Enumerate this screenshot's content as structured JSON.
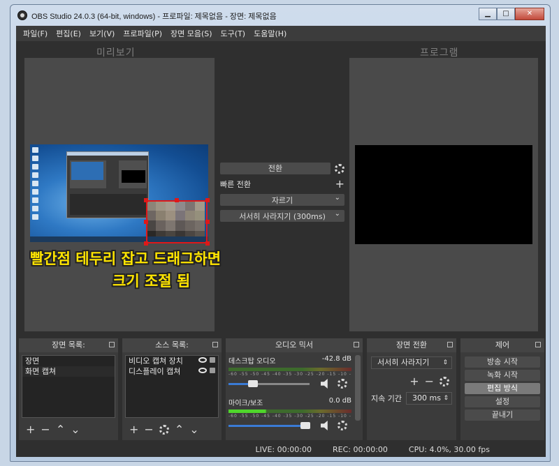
{
  "window": {
    "title": "OBS Studio 24.0.3 (64-bit, windows) - 프로파일: 제목없음 - 장면: 제목없음",
    "minimize": "▁",
    "maximize": "□",
    "close": "✕"
  },
  "menu": [
    "파일(F)",
    "편집(E)",
    "보기(V)",
    "프로파일(P)",
    "장면 모음(S)",
    "도구(T)",
    "도움말(H)"
  ],
  "preview_label": "미리보기",
  "program_label": "프로그램",
  "annotation": {
    "line1": "빨간점 테두리 잡고 드래그하면",
    "line2": "크기 조절 됨"
  },
  "transition_panel": {
    "transition_button": "전환",
    "quick_transition": "빠른 전환",
    "quick_plus": "+",
    "cut_option": "자르기",
    "fade_option": "서서히 사라지기 (300ms)"
  },
  "docks": {
    "scenes": {
      "title": "장면 목록:",
      "items": [
        "장면",
        "화면 캡쳐"
      ]
    },
    "sources": {
      "title": "소스 목록:",
      "items": [
        "비디오 캡쳐 장치",
        "디스플레이 캡쳐"
      ]
    },
    "mixer": {
      "title": "오디오 믹서",
      "ticks": "-60 -55 -50 -45 -40 -35 -30 -25 -20 -15 -10 -5 0",
      "channels": [
        {
          "name": "데스크탑 오디오",
          "level": "-42.8 dB",
          "volume": 0.3
        },
        {
          "name": "마이크/보조",
          "level": "0.0 dB",
          "volume": 0.95
        }
      ]
    },
    "scene_transition": {
      "title": "장면 전환",
      "selected": "서서히 사라지기",
      "duration_label": "지속 기간",
      "duration_value": "300 ms"
    },
    "controls": {
      "title": "제어",
      "buttons": [
        "방송 시작",
        "녹화 시작",
        "편집 방식",
        "설정",
        "끝내기"
      ]
    }
  },
  "status": {
    "live": "LIVE: 00:00:00",
    "rec": "REC: 00:00:00",
    "cpu": "CPU: 4.0%, 30.00 fps"
  }
}
